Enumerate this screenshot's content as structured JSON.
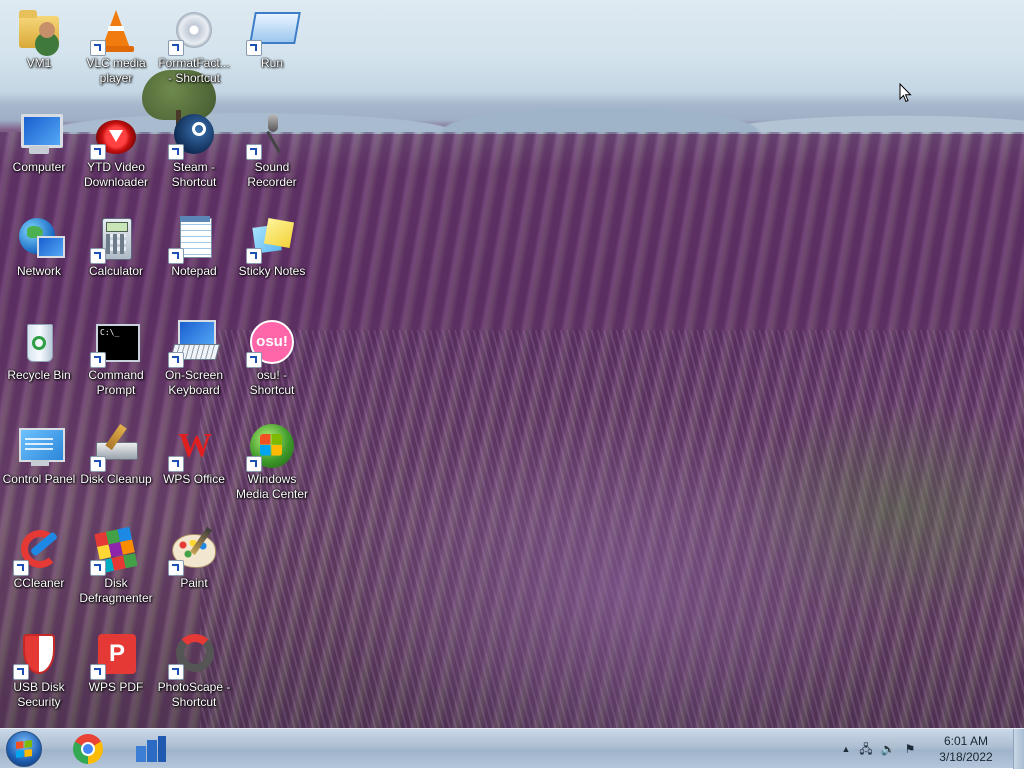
{
  "desktop": {
    "icons": [
      {
        "label": "VM1",
        "icon": "user-folder-icon",
        "shortcut": false
      },
      {
        "label": "VLC media player",
        "icon": "vlc-cone-icon",
        "shortcut": true
      },
      {
        "label": "FormatFact... - Shortcut",
        "icon": "format-factory-icon",
        "shortcut": true
      },
      {
        "label": "Run",
        "icon": "run-window-icon",
        "shortcut": true
      },
      {
        "label": "Computer",
        "icon": "computer-monitor-icon",
        "shortcut": false
      },
      {
        "label": "YTD Video Downloader",
        "icon": "ytd-downloader-icon",
        "shortcut": true
      },
      {
        "label": "Steam - Shortcut",
        "icon": "steam-icon",
        "shortcut": true
      },
      {
        "label": "Sound Recorder",
        "icon": "microphone-icon",
        "shortcut": true
      },
      {
        "label": "Network",
        "icon": "network-globe-icon",
        "shortcut": false
      },
      {
        "label": "Calculator",
        "icon": "calculator-icon",
        "shortcut": true
      },
      {
        "label": "Notepad",
        "icon": "notepad-icon",
        "shortcut": true
      },
      {
        "label": "Sticky Notes",
        "icon": "sticky-notes-icon",
        "shortcut": true
      },
      {
        "label": "Recycle Bin",
        "icon": "recycle-bin-icon",
        "shortcut": false
      },
      {
        "label": "Command Prompt",
        "icon": "command-prompt-icon",
        "shortcut": true
      },
      {
        "label": "On-Screen Keyboard",
        "icon": "keyboard-icon",
        "shortcut": true
      },
      {
        "label": "osu! - Shortcut",
        "icon": "osu-icon",
        "shortcut": true
      },
      {
        "label": "Control Panel",
        "icon": "control-panel-icon",
        "shortcut": false
      },
      {
        "label": "Disk Cleanup",
        "icon": "disk-cleanup-icon",
        "shortcut": true
      },
      {
        "label": "WPS Office",
        "icon": "wps-office-icon",
        "shortcut": true
      },
      {
        "label": "Windows Media Center",
        "icon": "media-center-icon",
        "shortcut": true
      },
      {
        "label": "CCleaner",
        "icon": "ccleaner-icon",
        "shortcut": true
      },
      {
        "label": "Disk Defragmenter",
        "icon": "defragmenter-icon",
        "shortcut": true
      },
      {
        "label": "Paint",
        "icon": "paint-palette-icon",
        "shortcut": true
      },
      {
        "label": "USB Disk Security",
        "icon": "usb-shield-icon",
        "shortcut": true
      },
      {
        "label": "WPS PDF",
        "icon": "wps-pdf-icon",
        "shortcut": true
      },
      {
        "label": "PhotoScape - Shortcut",
        "icon": "photoscape-icon",
        "shortcut": true
      }
    ],
    "osu_badge": "osu!",
    "cmd_text": "C:\\_",
    "wps_letter": "W",
    "pdf_letter": "P"
  },
  "taskbar": {
    "pinned": [
      {
        "name": "chrome",
        "icon": "chrome-icon"
      },
      {
        "name": "file-explorer",
        "icon": "explorer-icon"
      }
    ],
    "tray": {
      "chevron": "▲",
      "network": "🖧",
      "volume": "🔊",
      "flag": "⚑"
    },
    "clock": {
      "time": "6:01 AM",
      "date": "3/18/2022"
    }
  }
}
